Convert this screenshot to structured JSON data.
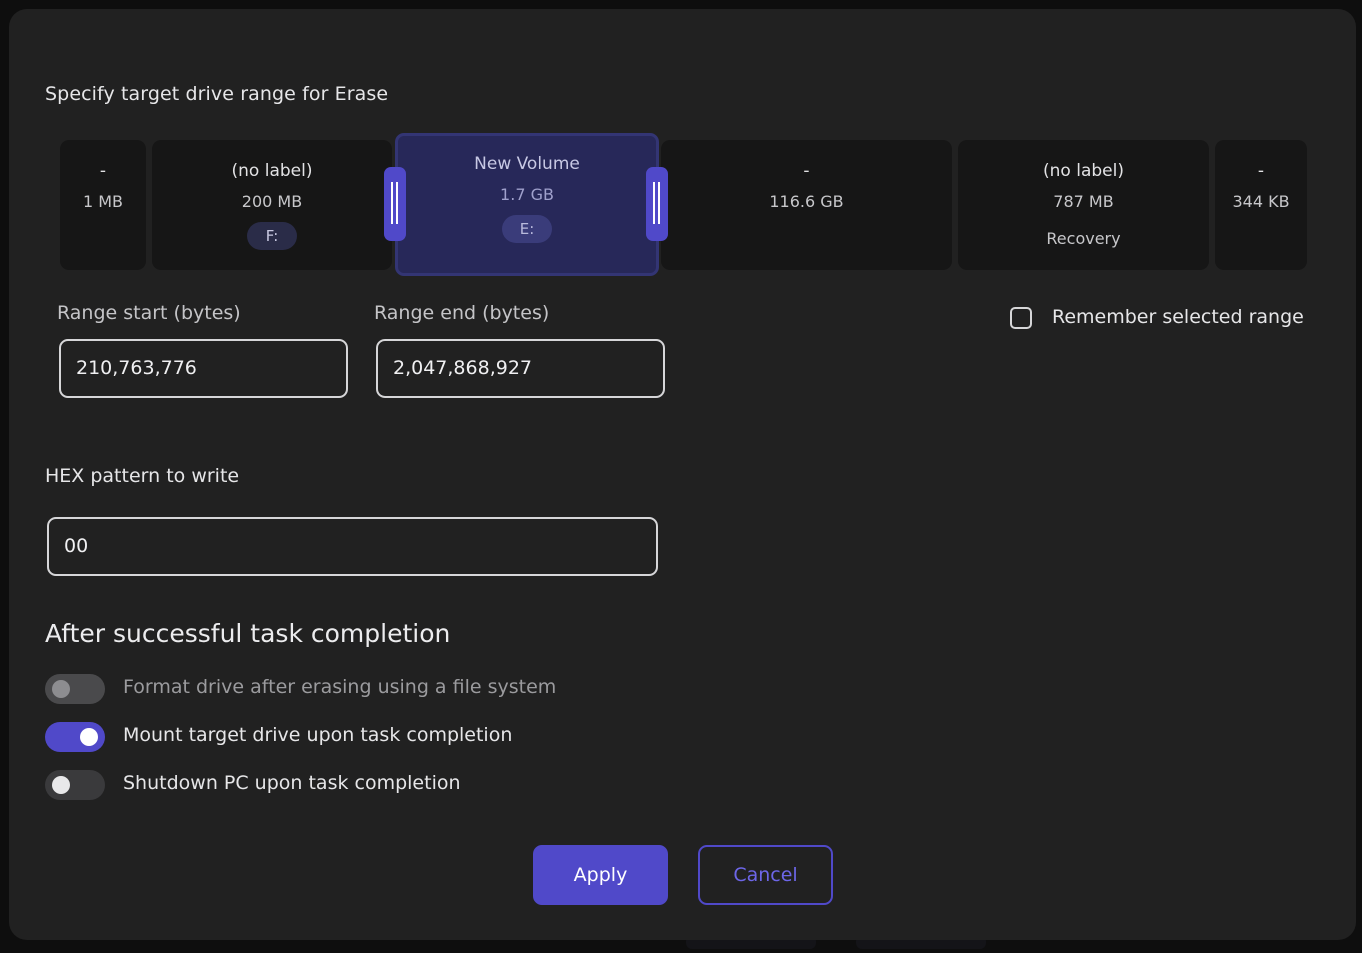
{
  "range_section": {
    "title": "Specify target drive range for Erase"
  },
  "partitions": [
    {
      "label": "-",
      "size": "1 MB",
      "letter": "",
      "extra": ""
    },
    {
      "label": "(no label)",
      "size": "200 MB",
      "letter": "F:",
      "extra": ""
    },
    {
      "label": "New Volume",
      "size": "1.7 GB",
      "letter": "E:",
      "extra": "",
      "selected": true
    },
    {
      "label": "-",
      "size": "116.6 GB",
      "letter": "",
      "extra": ""
    },
    {
      "label": "(no label)",
      "size": "787 MB",
      "letter": "",
      "extra": "Recovery"
    },
    {
      "label": "-",
      "size": "344 KB",
      "letter": "",
      "extra": ""
    }
  ],
  "range": {
    "start_label": "Range start (bytes)",
    "start_value": "210,763,776",
    "end_label": "Range end (bytes)",
    "end_value": "2,047,868,927",
    "remember_label": "Remember selected range",
    "remember_checked": false
  },
  "hex": {
    "label": "HEX pattern to write",
    "value": "00"
  },
  "completion": {
    "heading": "After successful task completion",
    "options": [
      {
        "label": "Format drive after erasing using a file system",
        "enabled": false,
        "disabled": true
      },
      {
        "label": "Mount target drive upon task completion",
        "enabled": true,
        "disabled": false
      },
      {
        "label": "Shutdown PC upon task completion",
        "enabled": false,
        "disabled": false
      }
    ]
  },
  "buttons": {
    "apply": "Apply",
    "cancel": "Cancel"
  },
  "colors": {
    "accent": "#5049c9",
    "dialog_bg": "#212121",
    "partition_bg": "#161616",
    "selected_partition_bg": "#272859"
  }
}
